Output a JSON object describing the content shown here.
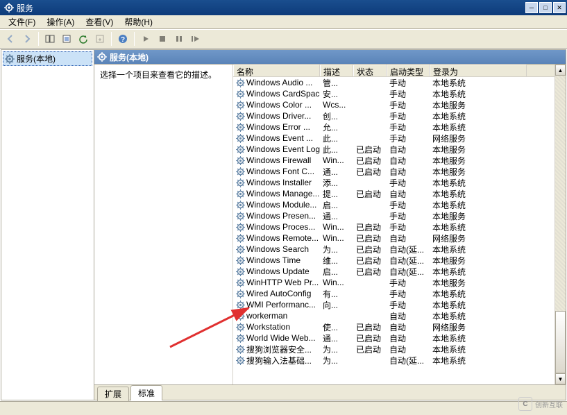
{
  "window": {
    "title": "服务"
  },
  "menu": {
    "file": "文件(F)",
    "action": "操作(A)",
    "view": "查看(V)",
    "help": "帮助(H)"
  },
  "tree": {
    "root": "服务(本地)"
  },
  "headerpane": {
    "title": "服务(本地)"
  },
  "description": {
    "prompt": "选择一个项目来查看它的描述。"
  },
  "columns": {
    "name": "名称",
    "desc": "描述",
    "status": "状态",
    "startup": "启动类型",
    "logon": "登录为",
    "w_name": 125,
    "w_desc": 48,
    "w_status": 48,
    "w_startup": 62,
    "w_logon": 140
  },
  "tabs": {
    "extended": "扩展",
    "standard": "标准"
  },
  "watermark": {
    "text": "创新互联"
  },
  "services": [
    {
      "name": "Windows Audio ...",
      "desc": "管...",
      "status": "",
      "startup": "手动",
      "logon": "本地系统"
    },
    {
      "name": "Windows CardSpace",
      "desc": "安...",
      "status": "",
      "startup": "手动",
      "logon": "本地系统"
    },
    {
      "name": "Windows Color ...",
      "desc": "Wcs...",
      "status": "",
      "startup": "手动",
      "logon": "本地服务"
    },
    {
      "name": "Windows Driver...",
      "desc": "创...",
      "status": "",
      "startup": "手动",
      "logon": "本地系统"
    },
    {
      "name": "Windows Error ...",
      "desc": "允...",
      "status": "",
      "startup": "手动",
      "logon": "本地系统"
    },
    {
      "name": "Windows Event ...",
      "desc": "此...",
      "status": "",
      "startup": "手动",
      "logon": "网络服务"
    },
    {
      "name": "Windows Event Log",
      "desc": "此...",
      "status": "已启动",
      "startup": "自动",
      "logon": "本地服务"
    },
    {
      "name": "Windows Firewall",
      "desc": "Win...",
      "status": "已启动",
      "startup": "自动",
      "logon": "本地服务"
    },
    {
      "name": "Windows Font C...",
      "desc": "通...",
      "status": "已启动",
      "startup": "自动",
      "logon": "本地服务"
    },
    {
      "name": "Windows Installer",
      "desc": "添...",
      "status": "",
      "startup": "手动",
      "logon": "本地系统"
    },
    {
      "name": "Windows Manage...",
      "desc": "提...",
      "status": "已启动",
      "startup": "自动",
      "logon": "本地系统"
    },
    {
      "name": "Windows Module...",
      "desc": "启...",
      "status": "",
      "startup": "手动",
      "logon": "本地系统"
    },
    {
      "name": "Windows Presen...",
      "desc": "通...",
      "status": "",
      "startup": "手动",
      "logon": "本地服务"
    },
    {
      "name": "Windows Proces...",
      "desc": "Win...",
      "status": "已启动",
      "startup": "手动",
      "logon": "本地系统"
    },
    {
      "name": "Windows Remote...",
      "desc": "Win...",
      "status": "已启动",
      "startup": "自动",
      "logon": "网络服务"
    },
    {
      "name": "Windows Search",
      "desc": "为...",
      "status": "已启动",
      "startup": "自动(延...",
      "logon": "本地系统"
    },
    {
      "name": "Windows Time",
      "desc": "维...",
      "status": "已启动",
      "startup": "自动(延...",
      "logon": "本地服务"
    },
    {
      "name": "Windows Update",
      "desc": "启...",
      "status": "已启动",
      "startup": "自动(延...",
      "logon": "本地系统"
    },
    {
      "name": "WinHTTP Web Pr...",
      "desc": "Win...",
      "status": "",
      "startup": "手动",
      "logon": "本地服务"
    },
    {
      "name": "Wired AutoConfig",
      "desc": "有...",
      "status": "",
      "startup": "手动",
      "logon": "本地系统"
    },
    {
      "name": "WMI Performanc...",
      "desc": "向...",
      "status": "",
      "startup": "手动",
      "logon": "本地系统"
    },
    {
      "name": "workerman",
      "desc": "",
      "status": "",
      "startup": "自动",
      "logon": "本地系统"
    },
    {
      "name": "Workstation",
      "desc": "使...",
      "status": "已启动",
      "startup": "自动",
      "logon": "网络服务"
    },
    {
      "name": "World Wide Web...",
      "desc": "通...",
      "status": "已启动",
      "startup": "自动",
      "logon": "本地系统"
    },
    {
      "name": "搜狗浏览器安全...",
      "desc": "为...",
      "status": "已启动",
      "startup": "自动",
      "logon": "本地系统"
    },
    {
      "name": "搜狗输入法基础...",
      "desc": "为...",
      "status": "",
      "startup": "自动(延...",
      "logon": "本地系统"
    }
  ]
}
